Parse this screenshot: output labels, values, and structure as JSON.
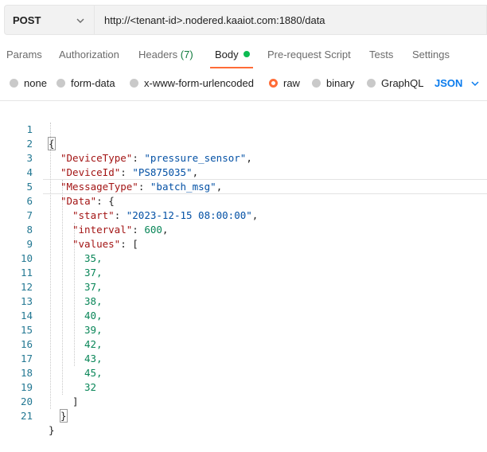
{
  "request": {
    "method": "POST",
    "url": "http://<tenant-id>.nodered.kaaiot.com:1880/data"
  },
  "tabs": [
    {
      "label": "Params"
    },
    {
      "label": "Authorization"
    },
    {
      "label": "Headers",
      "count": "(7)"
    },
    {
      "label": "Body",
      "active": true
    },
    {
      "label": "Pre-request Script"
    },
    {
      "label": "Tests"
    },
    {
      "label": "Settings"
    }
  ],
  "body_types": [
    {
      "label": "none"
    },
    {
      "label": "form-data"
    },
    {
      "label": "x-www-form-urlencoded"
    },
    {
      "label": "raw",
      "selected": true
    },
    {
      "label": "binary"
    },
    {
      "label": "GraphQL"
    }
  ],
  "format": "JSON",
  "colors": {
    "accent": "#ff6c37",
    "link": "#097bed",
    "active_dot": "#0cbb52",
    "json_key": "#a31515",
    "json_string": "#0451a5",
    "json_number": "#098658",
    "line_number": "#237893"
  },
  "editor": {
    "current_line": 6,
    "lines": [
      {
        "n": "1",
        "text": "{"
      },
      {
        "n": "2",
        "text": "\"DeviceType\": \"pressure_sensor\","
      },
      {
        "n": "3",
        "text": "\"DeviceId\": \"PS875035\","
      },
      {
        "n": "4",
        "text": "\"MessageType\": \"batch_msg\","
      },
      {
        "n": "5",
        "text": "\"Data\": {"
      },
      {
        "n": "6",
        "text": "\"start\": \"2023-12-15 08:00:00\","
      },
      {
        "n": "7",
        "text": "\"interval\": 600,"
      },
      {
        "n": "8",
        "text": "\"values\": ["
      },
      {
        "n": "9",
        "text": "35,"
      },
      {
        "n": "10",
        "text": "37,"
      },
      {
        "n": "11",
        "text": "37,"
      },
      {
        "n": "12",
        "text": "38,"
      },
      {
        "n": "13",
        "text": "40,"
      },
      {
        "n": "14",
        "text": "39,"
      },
      {
        "n": "15",
        "text": "42,"
      },
      {
        "n": "16",
        "text": "43,"
      },
      {
        "n": "17",
        "text": "45,"
      },
      {
        "n": "18",
        "text": "32"
      },
      {
        "n": "19",
        "text": "]"
      },
      {
        "n": "20",
        "text": "}"
      },
      {
        "n": "21",
        "text": "}"
      }
    ]
  }
}
